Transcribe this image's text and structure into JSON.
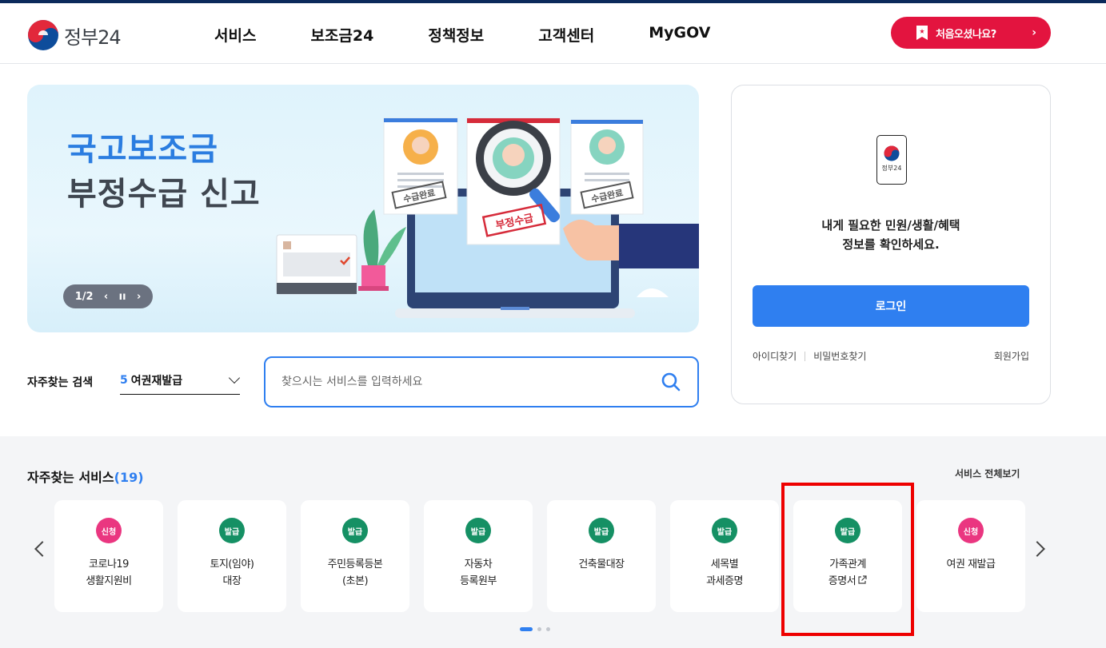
{
  "header": {
    "logo_text": "정부24",
    "nav": [
      "서비스",
      "보조금24",
      "정책정보",
      "고객센터",
      "MyGOV"
    ],
    "cta_label": "처음오셨나요?",
    "cta_arrow": "›"
  },
  "banner": {
    "title_line1": "국고보조금",
    "title_line2": "부정수급 신고",
    "pager": "1/2",
    "stamp_done": "수급완료",
    "stamp_fraud": "부정수급"
  },
  "login": {
    "phone_label": "정부24",
    "message_line1": "내게 필요한 민원/생활/혜택",
    "message_line2": "정보를 확인하세요.",
    "login_button": "로그인",
    "find_id": "아이디찾기",
    "find_pw": "비밀번호찾기",
    "join": "회원가입"
  },
  "search": {
    "frequent_label": "자주찾는 검색",
    "frequent_rank": "5",
    "frequent_value": "여권재발급",
    "placeholder": "찾으시는 서비스를 입력하세요"
  },
  "services": {
    "title": "자주찾는 서비스",
    "count": "(19)",
    "view_all": "서비스 전체보기",
    "cards": [
      {
        "badge": "신청",
        "name": "코로나19\n생활지원비"
      },
      {
        "badge": "발급",
        "name": "토지(임야)\n대장"
      },
      {
        "badge": "발급",
        "name": "주민등록등본\n(초본)"
      },
      {
        "badge": "발급",
        "name": "자동차\n등록원부"
      },
      {
        "badge": "발급",
        "name": "건축물대장"
      },
      {
        "badge": "발급",
        "name": "세목별\n과세증명"
      },
      {
        "badge": "발급",
        "name": "가족관계\n증명서"
      },
      {
        "badge": "신청",
        "name": "여권 재발급"
      }
    ]
  },
  "colors": {
    "accent": "#2f7ff0",
    "cta": "#e3143f",
    "badge_apply": "#ea3680",
    "badge_issue": "#159064"
  }
}
